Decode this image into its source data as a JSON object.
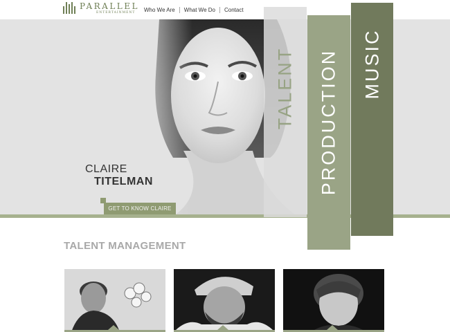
{
  "brand": {
    "name": "PARALLEL",
    "subtitle": "ENTERTAINMENT"
  },
  "nav": {
    "items": [
      {
        "label": "Who We Are"
      },
      {
        "label": "What We Do"
      },
      {
        "label": "Contact"
      }
    ]
  },
  "hero": {
    "first_name": "CLAIRE",
    "last_name": "TITELMAN",
    "cta_label": "GET TO KNOW CLAIRE"
  },
  "panels": {
    "talent": "TALENT",
    "production": "PRODUCTION",
    "music": "MUSIC"
  },
  "section": {
    "title": "TALENT MANAGEMENT"
  },
  "colors": {
    "accent_light": "#9aa486",
    "accent_dark": "#717a5c",
    "hero_bg": "#e3e3e3"
  }
}
